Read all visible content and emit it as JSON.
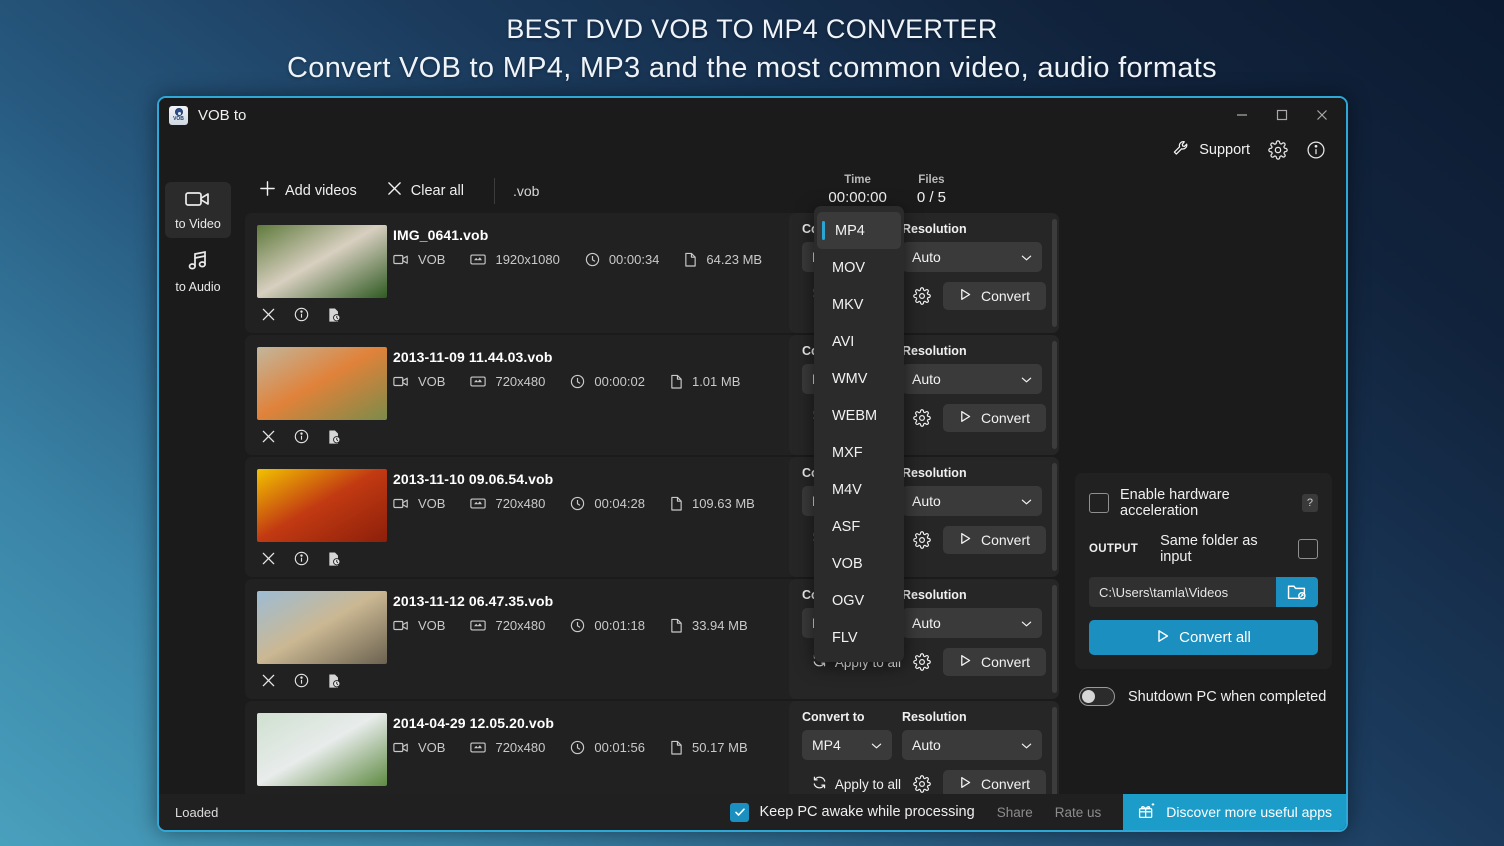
{
  "promo": {
    "line1": "BEST DVD VOB TO MP4 CONVERTER",
    "line2": "Convert VOB to MP4, MP3 and the most common video, audio formats"
  },
  "window": {
    "title": "VOB to",
    "controls": {
      "minimize": "minimize-icon",
      "maximize": "maximize-icon",
      "close": "close-icon"
    }
  },
  "topbar": {
    "support_label": "Support",
    "settings_icon": "gear-icon",
    "info_icon": "info-icon"
  },
  "sidebar": {
    "items": [
      {
        "label": "to Video",
        "icon": "video-camera-icon",
        "active": true
      },
      {
        "label": "to Audio",
        "icon": "music-note-icon",
        "active": false
      }
    ]
  },
  "actionbar": {
    "add_videos": "Add videos",
    "clear_all": "Clear all",
    "extension_filter": ".vob"
  },
  "counters": [
    {
      "key": "Time",
      "value": "00:00:00"
    },
    {
      "key": "Files",
      "value": "0 / 5"
    }
  ],
  "labels": {
    "convert_to": "Convert to",
    "resolution": "Resolution",
    "apply_to_all": "Apply to all",
    "convert": "Convert"
  },
  "files": [
    {
      "name": "IMG_0641.vob",
      "format": "VOB",
      "resolution_px": "1920x1080",
      "duration": "00:00:34",
      "size": "64.23 MB",
      "convert_to": "MP4",
      "resolution": "Auto",
      "thumb_colors": [
        "#5f7a3c",
        "#d8cfc0",
        "#2f5a22"
      ]
    },
    {
      "name": "2013-11-09 11.44.03.vob",
      "format": "VOB",
      "resolution_px": "720x480",
      "duration": "00:00:02",
      "size": "1.01 MB",
      "convert_to": "MP4",
      "resolution": "Auto",
      "thumb_colors": [
        "#c2b69c",
        "#e0823a",
        "#7c8b4a"
      ]
    },
    {
      "name": "2013-11-10 09.06.54.vob",
      "format": "VOB",
      "resolution_px": "720x480",
      "duration": "00:04:28",
      "size": "109.63 MB",
      "convert_to": "MP4",
      "resolution": "Auto",
      "thumb_colors": [
        "#f2c200",
        "#c23a12",
        "#8c1f0a"
      ]
    },
    {
      "name": "2013-11-12 06.47.35.vob",
      "format": "VOB",
      "resolution_px": "720x480",
      "duration": "00:01:18",
      "size": "33.94 MB",
      "convert_to": "MP4",
      "resolution": "Auto",
      "thumb_colors": [
        "#9dbcd4",
        "#cbb893",
        "#6b6250"
      ]
    },
    {
      "name": "2014-04-29 12.05.20.vob",
      "format": "VOB",
      "resolution_px": "720x480",
      "duration": "00:01:56",
      "size": "50.17 MB",
      "convert_to": "MP4",
      "resolution": "Auto",
      "thumb_colors": [
        "#cfe0d0",
        "#e8eceb",
        "#5e8a42"
      ]
    }
  ],
  "dropdown": {
    "selected": "MP4",
    "options": [
      "MP4",
      "MOV",
      "MKV",
      "AVI",
      "WMV",
      "WEBM",
      "MXF",
      "M4V",
      "ASF",
      "VOB",
      "OGV",
      "FLV"
    ]
  },
  "settings": {
    "hardware_acceleration": "Enable hardware acceleration",
    "hardware_acceleration_checked": false,
    "help_glyph": "?",
    "output_label": "OUTPUT",
    "same_folder": "Same folder as input",
    "same_folder_checked": false,
    "output_path": "C:\\Users\\tamla\\Videos",
    "browse_icon": "folder-open-icon",
    "convert_all": "Convert all",
    "shutdown_label": "Shutdown PC when completed",
    "shutdown_on": false
  },
  "statusbar": {
    "status": "Loaded",
    "keep_awake": "Keep PC awake while processing",
    "keep_awake_checked": true,
    "share": "Share",
    "rate_us": "Rate us",
    "discover": "Discover more useful apps"
  },
  "colors": {
    "accent": "#1b8fbf",
    "accent_bright": "#2fa8d8",
    "window_bg": "#1b1b1b",
    "row_bg": "#212121",
    "panel_bg": "#262626"
  }
}
